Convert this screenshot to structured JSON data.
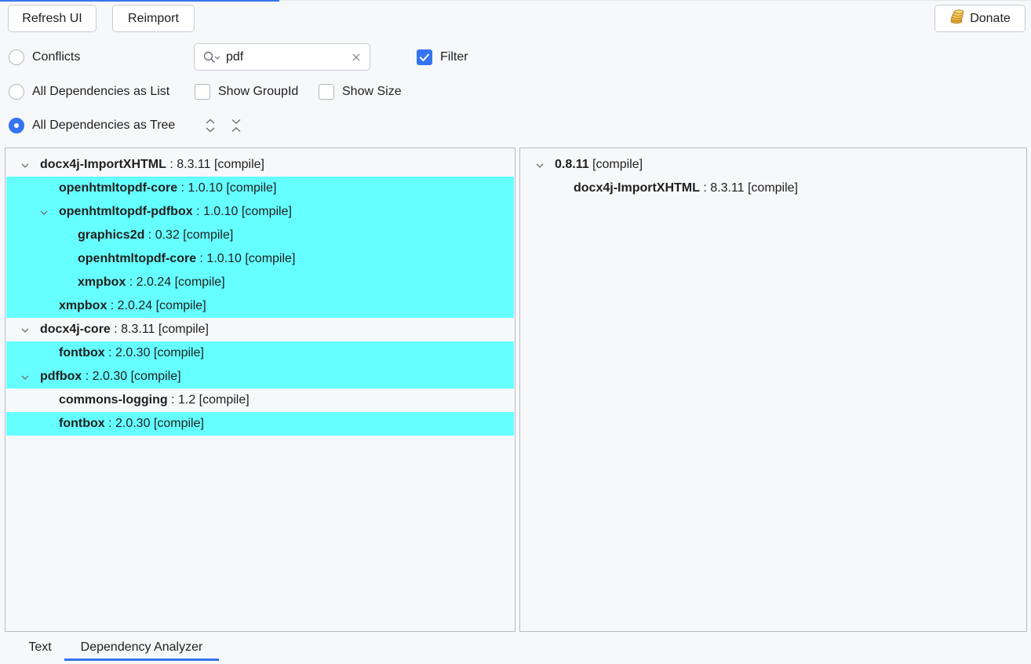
{
  "toolbar": {
    "refresh_label": "Refresh UI",
    "reimport_label": "Reimport",
    "donate_label": "Donate"
  },
  "options": {
    "conflicts_label": "Conflicts",
    "list_label": "All Dependencies as List",
    "tree_label": "All Dependencies as Tree",
    "selected_mode": "All Dependencies as Tree",
    "show_groupid_label": "Show GroupId",
    "show_groupid_checked": false,
    "show_size_label": "Show Size",
    "show_size_checked": false,
    "filter_label": "Filter",
    "filter_checked": true
  },
  "search": {
    "value": "pdf"
  },
  "left_tree": [
    {
      "name": "docx4j-ImportXHTML",
      "meta": " : 8.3.11 [compile]",
      "depth": 0,
      "expanded": true,
      "highlighted": false
    },
    {
      "name": "openhtmltopdf-core",
      "meta": " : 1.0.10 [compile]",
      "depth": 1,
      "expanded": null,
      "highlighted": true
    },
    {
      "name": "openhtmltopdf-pdfbox",
      "meta": " : 1.0.10 [compile]",
      "depth": 1,
      "expanded": true,
      "highlighted": true
    },
    {
      "name": "graphics2d",
      "meta": " : 0.32 [compile]",
      "depth": 2,
      "expanded": null,
      "highlighted": true
    },
    {
      "name": "openhtmltopdf-core",
      "meta": " : 1.0.10 [compile]",
      "depth": 2,
      "expanded": null,
      "highlighted": true
    },
    {
      "name": "xmpbox",
      "meta": " : 2.0.24 [compile]",
      "depth": 2,
      "expanded": null,
      "highlighted": true
    },
    {
      "name": "xmpbox",
      "meta": " : 2.0.24 [compile]",
      "depth": 1,
      "expanded": null,
      "highlighted": true
    },
    {
      "name": "docx4j-core",
      "meta": " : 8.3.11 [compile]",
      "depth": 0,
      "expanded": true,
      "highlighted": false
    },
    {
      "name": "fontbox",
      "meta": " : 2.0.30 [compile]",
      "depth": 1,
      "expanded": null,
      "highlighted": true
    },
    {
      "name": "pdfbox",
      "meta": " : 2.0.30 [compile]",
      "depth": 0,
      "expanded": true,
      "highlighted": true
    },
    {
      "name": "commons-logging",
      "meta": " : 1.2 [compile]",
      "depth": 1,
      "expanded": null,
      "highlighted": false
    },
    {
      "name": "fontbox",
      "meta": " : 2.0.30 [compile]",
      "depth": 1,
      "expanded": null,
      "highlighted": true
    }
  ],
  "right_tree": [
    {
      "name": "0.8.11",
      "meta": " [compile]",
      "depth": 0,
      "expanded": true,
      "highlighted": false
    },
    {
      "name": "docx4j-ImportXHTML",
      "meta": " : 8.3.11 [compile]",
      "depth": 1,
      "expanded": null,
      "highlighted": false
    }
  ],
  "tabs": [
    {
      "label": "Text",
      "active": false
    },
    {
      "label": "Dependency Analyzer",
      "active": true
    }
  ],
  "colors": {
    "accent": "#3574f0",
    "highlight": "#66ffff",
    "background": "#f7f8fa"
  }
}
